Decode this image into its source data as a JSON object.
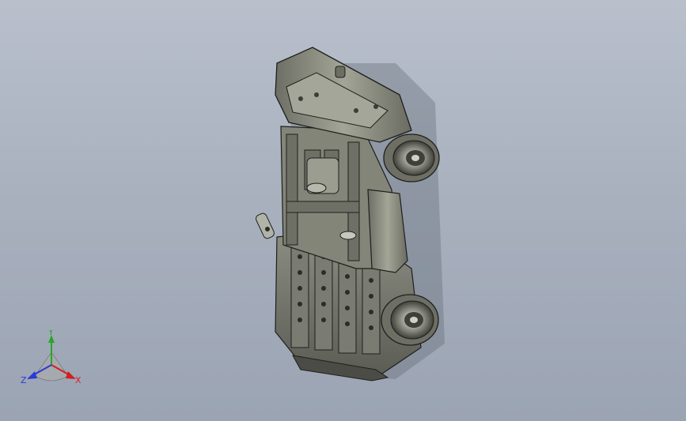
{
  "viewport": {
    "background_top": "#b9c0cc",
    "background_bottom": "#9ba4b3"
  },
  "model": {
    "icon": "assembly-model",
    "body_color": "#8f9184",
    "dark_color": "#4b4c45",
    "edge_color": "#1e1f1c"
  },
  "triad": {
    "x_label": "X",
    "y_label": "Y",
    "z_label": "Z",
    "x_color": "#d21f1f",
    "y_color": "#2aa52a",
    "z_color": "#2a3ad6"
  }
}
